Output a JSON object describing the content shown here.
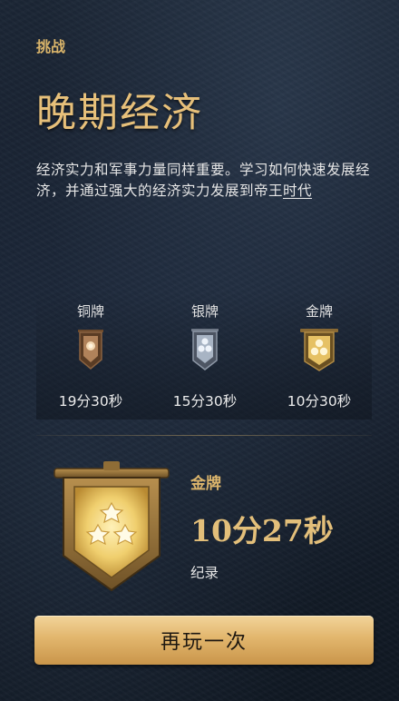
{
  "challenge": {
    "label": "挑战",
    "title": "晚期经济"
  },
  "description": {
    "text": "经济实力和军事力量同样重要。学习如何快速发展经济，并通过强大的经济实力发展到帝王",
    "link_text": "时代"
  },
  "medals": [
    {
      "name": "铜牌",
      "time": "19分30秒",
      "tier": "bronze",
      "icon": "bronze-banner-icon"
    },
    {
      "name": "银牌",
      "time": "15分30秒",
      "tier": "silver",
      "icon": "silver-banner-icon"
    },
    {
      "name": "金牌",
      "time": "10分30秒",
      "tier": "gold",
      "icon": "gold-banner-icon"
    }
  ],
  "result": {
    "medal_name": "金牌",
    "time": "10分27秒",
    "record_label": "纪录",
    "icon": "gold-banner-icon"
  },
  "replay_button": {
    "label": "再玩一次"
  },
  "colors": {
    "gold_text": "#e3bf7a",
    "bronze": "#b0825a",
    "silver": "#a8b4c4",
    "gold": "#e6c164",
    "button": "#e2b66d"
  }
}
